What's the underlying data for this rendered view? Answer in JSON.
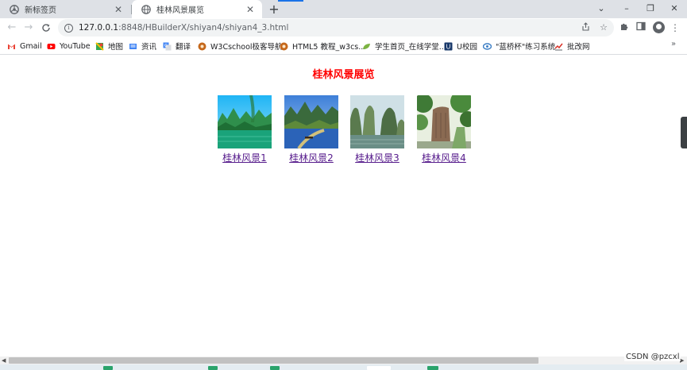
{
  "browser": {
    "tabs": [
      {
        "title": "新标签页",
        "active": false
      },
      {
        "title": "桂林风景展览",
        "active": true
      }
    ],
    "new_tab": "+",
    "window_controls": {
      "dropdown": "⌄",
      "minimize": "–",
      "restore": "❐",
      "close": "✕"
    },
    "toolbar": {
      "back": "←",
      "forward": "→",
      "reload": "C",
      "url_host": "127.0.0.1",
      "url_rest": ":8848/HBuilderX/shiyan4/shiyan4_3.html",
      "share_icon": "share-icon",
      "star_icon": "star-icon"
    },
    "bookmarks": [
      {
        "label": "Gmail",
        "color": "#ea4335"
      },
      {
        "label": "YouTube",
        "color": "#ff0000"
      },
      {
        "label": "地图",
        "color": "#34a853"
      },
      {
        "label": "资讯",
        "color": "#4285f4"
      },
      {
        "label": "翻译",
        "color": "#4285f4"
      },
      {
        "label": "W3Cschool极客导航",
        "color": "#c5681c"
      },
      {
        "label": "HTML5 教程_w3cs...",
        "color": "#c5681c"
      },
      {
        "label": "学生首页_在线学堂...",
        "color": "#7cb342"
      },
      {
        "label": "U校园",
        "color": "#1a3a6b"
      },
      {
        "label": "\"蓝桥杯\"练习系统",
        "color": "#3b7dc4"
      },
      {
        "label": "批改网",
        "color": "#d93025"
      }
    ],
    "bookmarks_more": "»"
  },
  "page": {
    "title": "桂林风景展览",
    "title_color": "#ff0000",
    "link_color": "#551a8b",
    "gallery": [
      {
        "caption": "桂林风景1",
        "image": "guilin-river-photo"
      },
      {
        "caption": "桂林风景2",
        "image": "guilin-boat-photo"
      },
      {
        "caption": "桂林风景3",
        "image": "guilin-peaks-photo"
      },
      {
        "caption": "桂林风景4",
        "image": "guilin-stone-tablet-photo"
      }
    ]
  },
  "status": {
    "watermark": "CSDN @pzcxl"
  }
}
